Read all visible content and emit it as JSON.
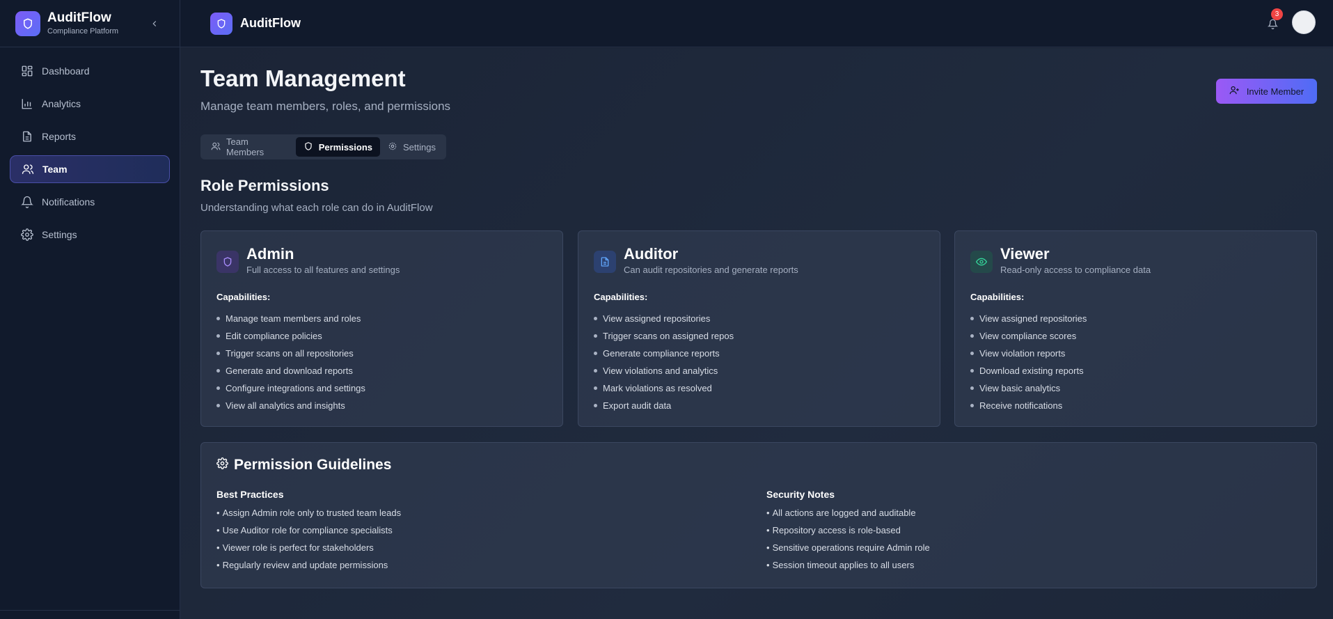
{
  "app": {
    "name": "AuditFlow",
    "subtitle": "Compliance Platform"
  },
  "sidebar": {
    "items": [
      {
        "label": "Dashboard",
        "icon": "dashboard-icon",
        "active": false
      },
      {
        "label": "Analytics",
        "icon": "bar-chart-icon",
        "active": false
      },
      {
        "label": "Reports",
        "icon": "document-icon",
        "active": false
      },
      {
        "label": "Team",
        "icon": "users-icon",
        "active": true
      },
      {
        "label": "Notifications",
        "icon": "bell-icon",
        "active": false
      },
      {
        "label": "Settings",
        "icon": "gear-icon",
        "active": false
      }
    ]
  },
  "topbar": {
    "title": "AuditFlow",
    "notification_count": "3"
  },
  "page": {
    "title": "Team Management",
    "subtitle": "Manage team members, roles, and permissions",
    "invite_label": "Invite Member"
  },
  "tabs": [
    {
      "label": "Team Members",
      "active": false
    },
    {
      "label": "Permissions",
      "active": true
    },
    {
      "label": "Settings",
      "active": false
    }
  ],
  "section": {
    "title": "Role Permissions",
    "subtitle": "Understanding what each role can do in AuditFlow",
    "capabilities_label": "Capabilities:"
  },
  "roles": [
    {
      "name": "Admin",
      "description": "Full access to all features and settings",
      "icon": "shield-icon",
      "accent": "#a78bfa",
      "capabilities": [
        "Manage team members and roles",
        "Edit compliance policies",
        "Trigger scans on all repositories",
        "Generate and download reports",
        "Configure integrations and settings",
        "View all analytics and insights"
      ]
    },
    {
      "name": "Auditor",
      "description": "Can audit repositories and generate reports",
      "icon": "document-icon",
      "accent": "#60a5fa",
      "capabilities": [
        "View assigned repositories",
        "Trigger scans on assigned repos",
        "Generate compliance reports",
        "View violations and analytics",
        "Mark violations as resolved",
        "Export audit data"
      ]
    },
    {
      "name": "Viewer",
      "description": "Read-only access to compliance data",
      "icon": "eye-icon",
      "accent": "#34d399",
      "capabilities": [
        "View assigned repositories",
        "View compliance scores",
        "View violation reports",
        "Download existing reports",
        "View basic analytics",
        "Receive notifications"
      ]
    }
  ],
  "guidelines": {
    "title": "Permission Guidelines",
    "best_practices": {
      "heading": "Best Practices",
      "items": [
        "Assign Admin role only to trusted team leads",
        "Use Auditor role for compliance specialists",
        "Viewer role is perfect for stakeholders",
        "Regularly review and update permissions"
      ]
    },
    "security_notes": {
      "heading": "Security Notes",
      "items": [
        "All actions are logged and auditable",
        "Repository access is role-based",
        "Sensitive operations require Admin role",
        "Session timeout applies to all users"
      ]
    }
  }
}
